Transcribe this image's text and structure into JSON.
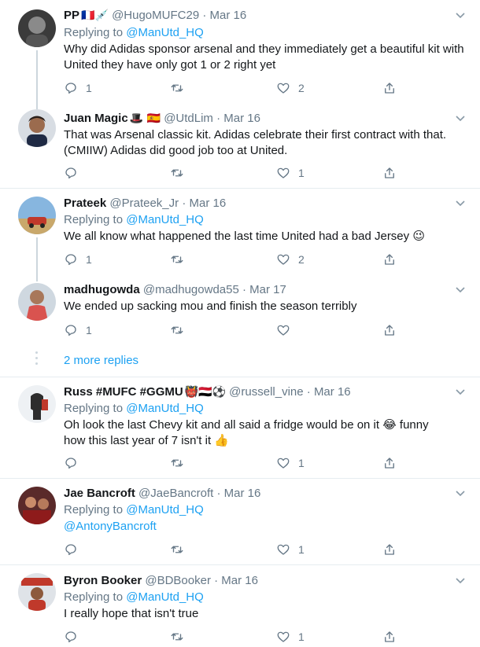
{
  "tweets": [
    {
      "name": "PP",
      "emoji": "🇫🇷💉",
      "handle": "@HugoMUFC29",
      "date": "Mar 16",
      "replying_label": "Replying to",
      "replying_to": "@ManUtd_HQ",
      "text": "Why did Adidas sponsor arsenal and they immediately get a beautiful kit with United they have only got 1 or 2 right yet",
      "replies": "1",
      "retweets": "",
      "likes": "2"
    },
    {
      "name": "Juan Magic",
      "emoji": "🎩 🇪🇸",
      "handle": "@UtdLim",
      "date": "Mar 16",
      "text": "That was Arsenal classic kit. Adidas celebrate their first contract with that. (CMIIW) Adidas did good job too at United.",
      "replies": "",
      "retweets": "",
      "likes": "1"
    },
    {
      "name": "Prateek",
      "emoji": "",
      "handle": "@Prateek_Jr",
      "date": "Mar 16",
      "replying_label": "Replying to",
      "replying_to": "@ManUtd_HQ",
      "text": "We all know what happened the last time United had a bad Jersey 😉",
      "replies": "1",
      "retweets": "",
      "likes": "2"
    },
    {
      "name": "madhugowda",
      "emoji": "",
      "handle": "@madhugowda55",
      "date": "Mar 17",
      "text": "We ended up sacking mou and finish the season terribly",
      "replies": "1",
      "retweets": "",
      "likes": ""
    },
    {
      "name": "Russ #MUFC #GGMU",
      "emoji": "👹🇾🇪⚽",
      "handle": "@russell_vine",
      "date": "Mar 16",
      "replying_label": "Replying to",
      "replying_to": "@ManUtd_HQ",
      "text1": "Oh look the last Chevy kit and all said a fridge would be on it 😂 funny",
      "text2": "how this last year of 7 isn't it 👍",
      "replies": "",
      "retweets": "",
      "likes": "1"
    },
    {
      "name": "Jae Bancroft",
      "emoji": "",
      "handle": "@JaeBancroft",
      "date": "Mar 16",
      "replying_label": "Replying to",
      "replying_to": "@ManUtd_HQ",
      "mention": "@AntonyBancroft",
      "replies": "",
      "retweets": "",
      "likes": "1"
    },
    {
      "name": "Byron Booker",
      "emoji": "",
      "handle": "@BDBooker",
      "date": "Mar 16",
      "replying_label": "Replying to",
      "replying_to": "@ManUtd_HQ",
      "text": "I really hope that isn't true",
      "replies": "",
      "retweets": "",
      "likes": "1"
    }
  ],
  "more_replies": "2 more replies",
  "separator_dot": "·",
  "colors": {
    "accent": "#1da1f2",
    "muted": "#657786",
    "border": "#e6ecf0"
  }
}
